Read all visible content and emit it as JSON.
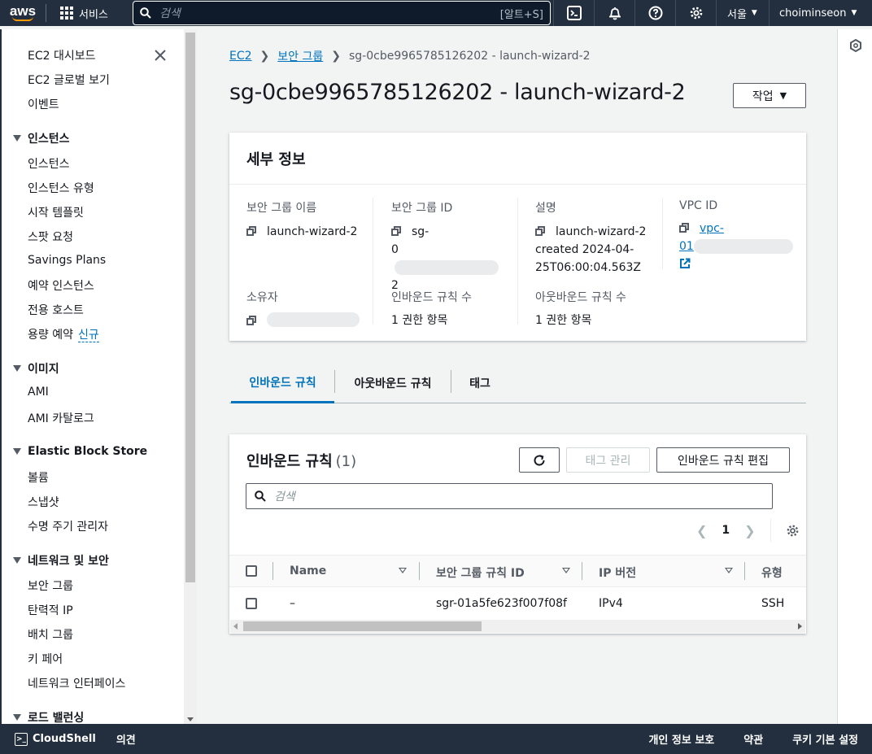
{
  "topnav": {
    "logo": "aws",
    "services": "서비스",
    "search_placeholder": "검색",
    "search_shortcut": "[알트+S]",
    "region": "서울",
    "user": "choiminseon"
  },
  "sidebar": {
    "top_items": [
      "EC2 대시보드",
      "EC2 글로벌 보기",
      "이벤트"
    ],
    "instances": {
      "header": "인스턴스",
      "items": [
        "인스턴스",
        "인스턴스 유형",
        "시작 템플릿",
        "스팟 요청",
        "Savings Plans",
        "예약 인스턴스",
        "전용 호스트",
        "용량 예약"
      ],
      "new_badge": "신규"
    },
    "images": {
      "header": "이미지",
      "items": [
        "AMI",
        "AMI 카탈로그"
      ]
    },
    "ebs": {
      "header": "Elastic Block Store",
      "items": [
        "볼륨",
        "스냅샷",
        "수명 주기 관리자"
      ]
    },
    "network": {
      "header": "네트워크 및 보안",
      "items": [
        "보안 그룹",
        "탄력적 IP",
        "배치 그룹",
        "키 페어",
        "네트워크 인터페이스"
      ]
    },
    "lb": {
      "header": "로드 밸런싱"
    }
  },
  "breadcrumb": {
    "ec2": "EC2",
    "sg": "보안 그룹",
    "current": "sg-0cbe9965785126202 - launch-wizard-2"
  },
  "page": {
    "title": "sg-0cbe9965785126202 - launch-wizard-2",
    "actions_button": "작업"
  },
  "details": {
    "heading": "세부 정보",
    "sg_name_label": "보안 그룹 이름",
    "sg_name": "launch-wizard-2",
    "sg_id_label": "보안 그룹 ID",
    "sg_id_line1": "sg-",
    "sg_id_line2": "0",
    "sg_id_line3": "2",
    "desc_label": "설명",
    "desc_line1": "launch-wizard-2",
    "desc_line2": "created 2024-04-",
    "desc_line3": "25T06:00:04.563Z",
    "vpc_label": "VPC ID",
    "vpc_line1": "vpc-",
    "vpc_line2": "01",
    "owner_label": "소유자",
    "inbound_count_label": "인바운드 규칙 수",
    "inbound_count": "1 권한 항목",
    "outbound_count_label": "아웃바운드 규칙 수",
    "outbound_count": "1 권한 항목"
  },
  "tabs": [
    "인바운드 규칙",
    "아웃바운드 규칙",
    "태그"
  ],
  "rules": {
    "title": "인바운드 규칙",
    "count": "(1)",
    "manage_tags": "태그 관리",
    "edit_button": "인바운드 규칙 편집",
    "search_placeholder": "검색",
    "page": "1",
    "columns": [
      "Name",
      "보안 그룹 규칙 ID",
      "IP 버전",
      "유형"
    ],
    "rows": [
      {
        "name": "–",
        "rule_id": "sgr-01a5fe623f007f08f",
        "ip_version": "IPv4",
        "type": "SSH"
      }
    ]
  },
  "bottombar": {
    "cloudshell": "CloudShell",
    "feedback": "의견",
    "privacy": "개인 정보 보호",
    "terms": "약관",
    "cookies": "쿠키 기본 설정"
  }
}
